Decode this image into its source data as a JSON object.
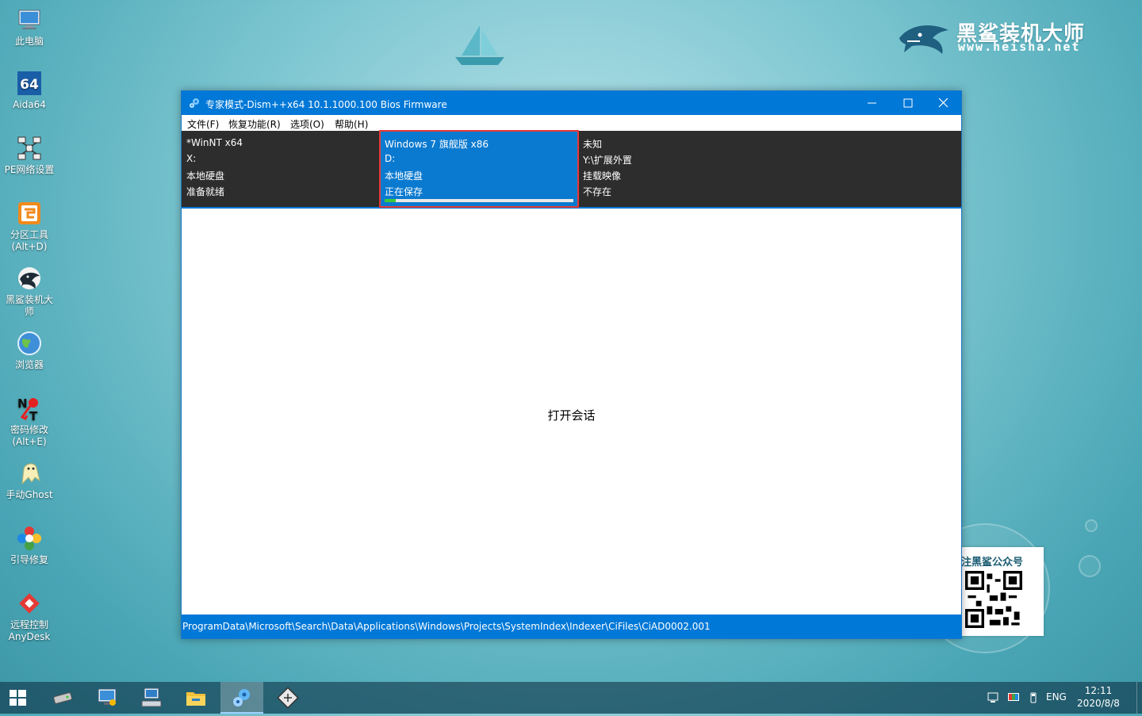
{
  "desktop": {
    "brand": {
      "name": "黑鲨装机大师",
      "url": "www.heisha.net"
    },
    "qr_card": {
      "title": "注黑鲨公众号"
    },
    "icons": [
      {
        "label": "此电脑",
        "icon": "computer-icon"
      },
      {
        "label": "Aida64",
        "icon": "aida64-icon"
      },
      {
        "label": "PE网络设置",
        "icon": "network-icon"
      },
      {
        "label": "分区工具\n(Alt+D)",
        "icon": "partition-icon"
      },
      {
        "label": "黑鲨装机大\n师",
        "icon": "shark-icon"
      },
      {
        "label": "浏览器",
        "icon": "browser-icon"
      },
      {
        "label": "密码修改\n(Alt+E)",
        "icon": "password-icon"
      },
      {
        "label": "手动Ghost",
        "icon": "ghost-icon"
      },
      {
        "label": "引导修复",
        "icon": "boot-repair-icon"
      },
      {
        "label": "远程控制\nAnyDesk",
        "icon": "anydesk-icon"
      }
    ]
  },
  "window": {
    "title": "专家模式-Dism++x64 10.1.1000.100 Bios Firmware",
    "menu": [
      "文件(F)",
      "恢复功能(R)",
      "选项(O)",
      "帮助(H)"
    ],
    "drives": [
      {
        "os": "*WinNT x64",
        "letter": "X:",
        "type": "本地硬盘",
        "status": "准备就绪"
      },
      {
        "os": "Windows 7 旗舰版 x86",
        "letter": "D:",
        "type": "本地硬盘",
        "status": "正在保存",
        "progress": 0.06
      },
      {
        "os": "未知",
        "letter": "Y:\\扩展外置",
        "type": "挂载映像",
        "status": "不存在"
      }
    ],
    "session_text": "打开会话",
    "status_path": "ProgramData\\Microsoft\\Search\\Data\\Applications\\Windows\\Projects\\SystemIndex\\Indexer\\CiFiles\\CiAD0002.001"
  },
  "taskbar": {
    "apps": [
      "hard-drive-icon",
      "monitor-network-icon",
      "keyboard-computer-icon",
      "file-explorer-icon",
      "dism-gears-icon",
      "disk-tool-icon"
    ],
    "active_app": "dism-gears-icon",
    "language": "ENG",
    "time": "12:11",
    "date": "2020/8/8"
  },
  "colors": {
    "accent": "#0078d7",
    "selection_border": "#e53935",
    "progress": "#3cc83c"
  }
}
